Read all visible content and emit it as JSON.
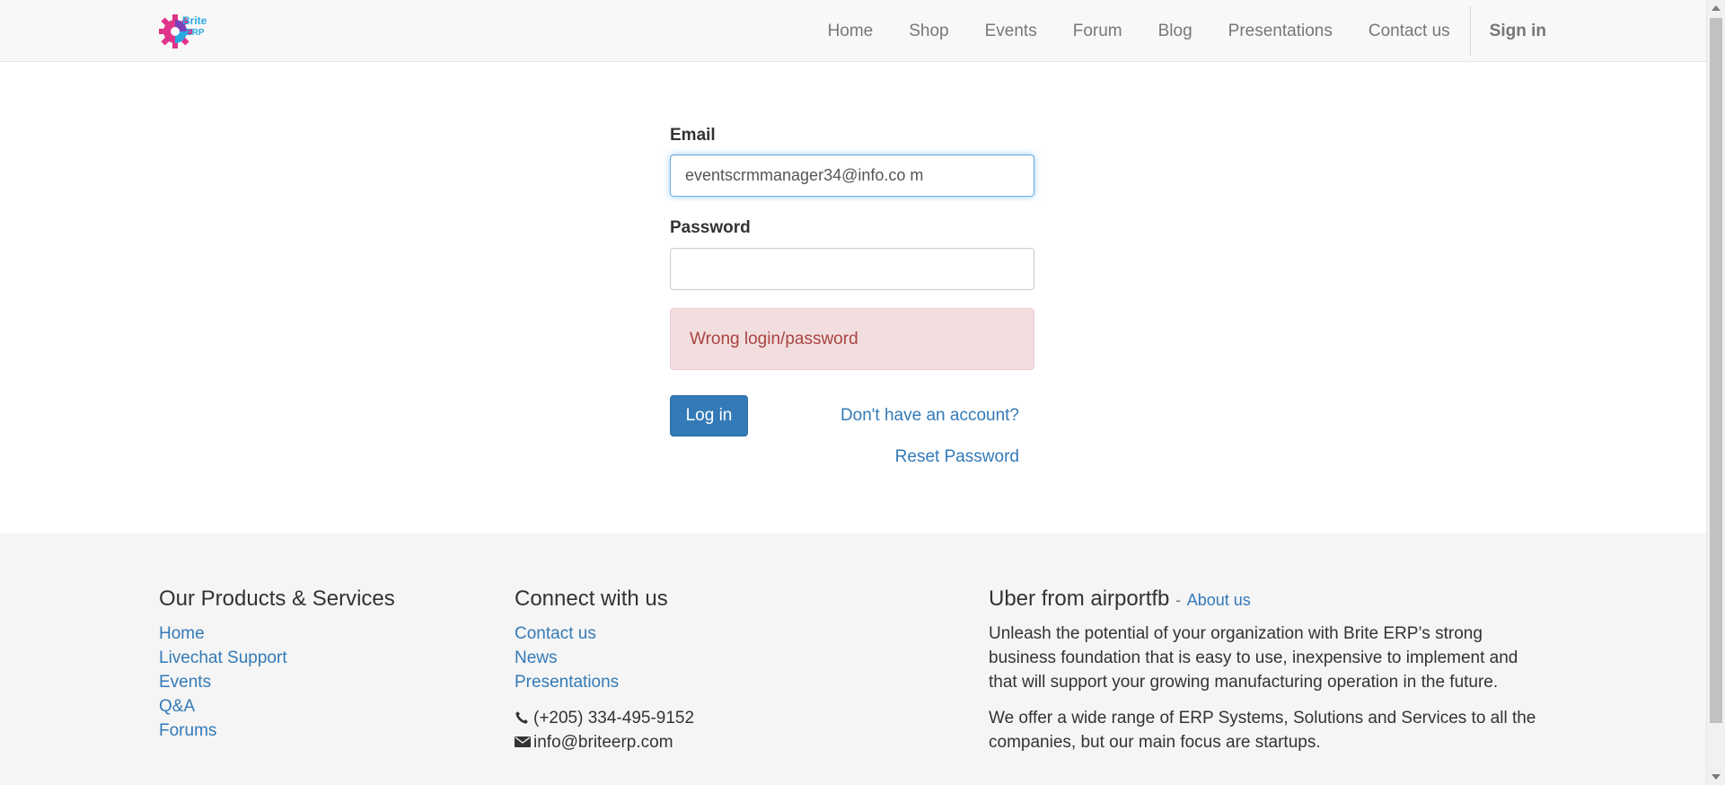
{
  "brand": {
    "logo_text": "Brite ERP"
  },
  "nav": {
    "items": [
      "Home",
      "Shop",
      "Events",
      "Forum",
      "Blog",
      "Presentations",
      "Contact us"
    ],
    "signin": "Sign in"
  },
  "login": {
    "email_label": "Email",
    "email_value": "eventscrmmanager34@info.co m",
    "password_label": "Password",
    "password_value": "",
    "error": "Wrong login/password",
    "login_button": "Log in",
    "signup_link": "Don't have an account?",
    "reset_link": "Reset Password"
  },
  "footer": {
    "products": {
      "title": "Our Products & Services",
      "links": [
        "Home",
        "Livechat Support",
        "Events",
        "Q&A",
        "Forums"
      ]
    },
    "connect": {
      "title": "Connect with us",
      "links": [
        "Contact us",
        "News",
        "Presentations"
      ],
      "phone": "(+205) 334-495-9152",
      "email": "info@briteerp.com"
    },
    "about": {
      "title": "Uber from airportfb",
      "separator": "-",
      "about_link": "About us",
      "paragraphs": [
        "Unleash the potential of your organization with Brite ERP’s strong business foundation that is easy to use, inexpensive to implement and that will support your growing manufacturing operation in the future.",
        "We offer a wide range of ERP Systems, Solutions and Services to all the companies, but our main focus are startups."
      ]
    }
  },
  "icons": {
    "phone": "phone-icon",
    "email": "envelope-icon",
    "logo": "gear-logo-icon"
  },
  "colors": {
    "link": "#337ab7",
    "primary_button": "#337ab7",
    "alert_bg": "#f2dede",
    "alert_text": "#a94442",
    "navbar_bg": "#f8f8f8",
    "footer_bg": "#f5f5f5"
  }
}
